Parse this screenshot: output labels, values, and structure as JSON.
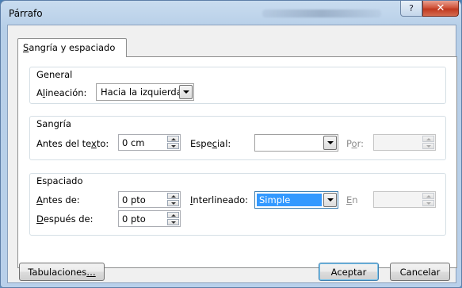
{
  "window": {
    "title": "Párrafo",
    "help_glyph": "?",
    "close_glyph": "✕"
  },
  "tabs": [
    {
      "label": "Sangría y espaciado",
      "accel": "S",
      "rest": "angría y espaciado",
      "active": true
    }
  ],
  "general": {
    "title": "General",
    "alignment_label_pre": "A",
    "alignment_label_accel": "l",
    "alignment_label_post": "ineación:",
    "alignment_value": "Hacia la izquierda"
  },
  "indent": {
    "title": "Sangría",
    "before_text_label_pre": "Antes del te",
    "before_text_label_accel": "x",
    "before_text_label_post": "to:",
    "before_text_value": "0 cm",
    "special_label_pre": "Espe",
    "special_label_accel": "c",
    "special_label_post": "ial:",
    "special_value": "",
    "by_label_pre": "P",
    "by_label_accel": "o",
    "by_label_post": "r:",
    "by_value": ""
  },
  "spacing": {
    "title": "Espaciado",
    "before_label_pre": "",
    "before_label_accel": "A",
    "before_label_post": "ntes de:",
    "before_value": "0 pto",
    "after_label_pre": "",
    "after_label_accel": "D",
    "after_label_post": "espués de:",
    "after_value": "0 pto",
    "line_label_pre": "",
    "line_label_accel": "I",
    "line_label_post": "nterlineado:",
    "line_value": "Simple",
    "at_label_pre": "",
    "at_label_accel": "E",
    "at_label_post": "n",
    "at_value": ""
  },
  "buttons": {
    "tabs_label_pre": "Tabulaciones",
    "tabs_label_accel": "…",
    "tabs_label_post": "",
    "ok_label": "Aceptar",
    "cancel_label": "Cancelar"
  },
  "colors": {
    "selection": "#3399ff",
    "close": "#c0391f",
    "title_bar": "#b7cfe8"
  }
}
